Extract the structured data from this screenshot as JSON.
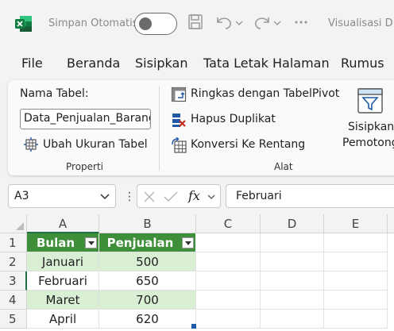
{
  "titlebar": {
    "autosave_label": "Simpan Otomatis",
    "autosave_on": false,
    "title": "Visualisasi D"
  },
  "menu": [
    "File",
    "Beranda",
    "Sisipkan",
    "Tata Letak Halaman",
    "Rumus"
  ],
  "ribbon": {
    "table_name_label": "Nama Tabel:",
    "table_name_value": "Data_Penjualan_Barang",
    "resize_table": "Ubah Ukuran Tabel",
    "group_properties": "Properti",
    "summarize_pivot": "Ringkas dengan TabelPivot",
    "remove_duplicates": "Hapus Duplikat",
    "convert_range": "Konversi Ke Rentang",
    "group_tools": "Alat",
    "insert_slicer_line1": "Sisipkan",
    "insert_slicer_line2": "Pemotong"
  },
  "formula_bar": {
    "name_box": "A3",
    "fx": "fx",
    "formula": "Februari"
  },
  "grid": {
    "columns": [
      "A",
      "B",
      "C",
      "D",
      "E"
    ],
    "rows": [
      "1",
      "2",
      "3",
      "4",
      "5"
    ],
    "headers": [
      "Bulan",
      "Penjualan"
    ],
    "data": [
      [
        "Januari",
        "500"
      ],
      [
        "Februari",
        "650"
      ],
      [
        "Maret",
        "700"
      ],
      [
        "April",
        "620"
      ]
    ]
  },
  "colors": {
    "excel_green": "#1e7145",
    "table_header": "#3f8f3a",
    "table_band": "#d9efd4"
  }
}
